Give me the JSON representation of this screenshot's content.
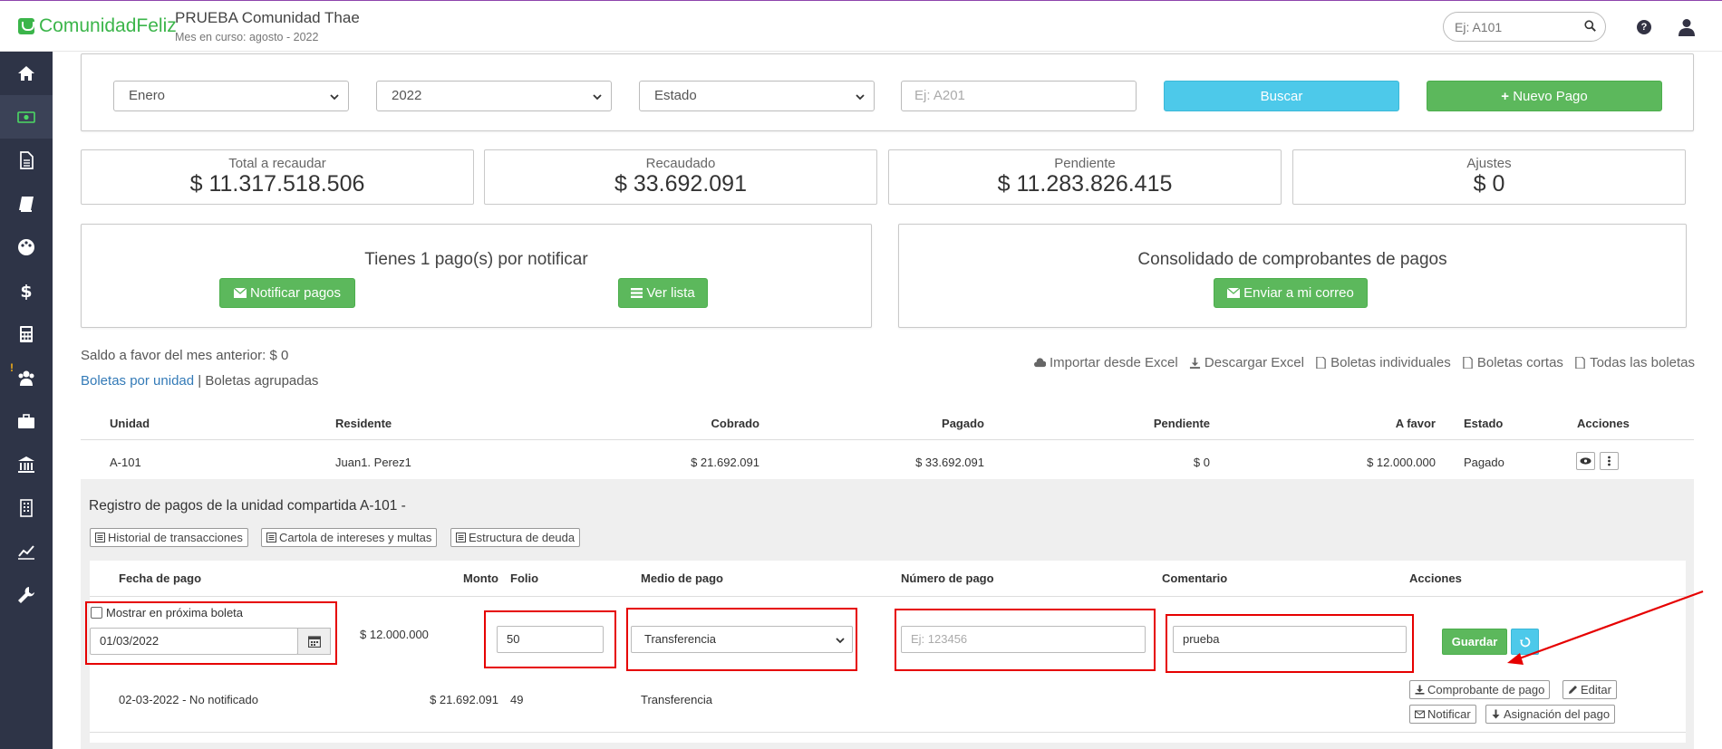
{
  "header": {
    "brand": "ComunidadFeliz",
    "community_name": "PRUEBA Comunidad Thae",
    "current_month": "Mes en curso: agosto - 2022",
    "search_placeholder": "Ej: A101"
  },
  "filters": {
    "month": "Enero",
    "year": "2022",
    "state": "Estado",
    "unit_placeholder": "Ej: A201",
    "search_label": "Buscar",
    "new_payment_label": "Nuevo Pago"
  },
  "stats": [
    {
      "label": "Total a recaudar",
      "value": "$ 11.317.518.506"
    },
    {
      "label": "Recaudado",
      "value": "$ 33.692.091"
    },
    {
      "label": "Pendiente",
      "value": "$ 11.283.826.415"
    },
    {
      "label": "Ajustes",
      "value": "$ 0"
    }
  ],
  "notify": {
    "title": "Tienes 1 pago(s) por notificar",
    "notify_label": "Notificar pagos",
    "list_label": "Ver lista"
  },
  "consolidated": {
    "title": "Consolidado de comprobantes de pagos",
    "email_label": "Enviar a mi correo"
  },
  "saldo": "Saldo a favor del mes anterior: $ 0",
  "views": {
    "by_unit": "Boletas por unidad",
    "separator": "|",
    "grouped": "Boletas agrupadas"
  },
  "tools": {
    "import": "Importar desde Excel",
    "download": "Descargar Excel",
    "individual": "Boletas individuales",
    "short": "Boletas cortas",
    "all": "Todas las boletas"
  },
  "table": {
    "headers": [
      "Unidad",
      "Residente",
      "Cobrado",
      "Pagado",
      "Pendiente",
      "A favor",
      "Estado",
      "Acciones"
    ],
    "row": [
      "A-101",
      "Juan1. Perez1",
      "$ 21.692.091",
      "$ 33.692.091",
      "$ 0",
      "$ 12.000.000",
      "Pagado"
    ]
  },
  "registry": {
    "title": "Registro de pagos de la unidad compartida A-101 -",
    "buttons": [
      "Historial de transacciones",
      "Cartola de intereses y multas",
      "Estructura de deuda"
    ],
    "headers": [
      "Fecha de pago",
      "Monto",
      "Folio",
      "Medio de pago",
      "Número de pago",
      "Comentario",
      "Acciones"
    ],
    "edit_row": {
      "checkbox_label": "Mostrar en próxima boleta",
      "date": "01/03/2022",
      "amount": "$ 12.000.000",
      "folio": "50",
      "method": "Transferencia",
      "number_placeholder": "Ej: 123456",
      "comment": "prueba",
      "save_label": "Guardar"
    },
    "row": {
      "date": "02-03-2022 - No notificado",
      "amount": "$ 21.692.091",
      "folio": "49",
      "method": "Transferencia",
      "actions": [
        "Comprobante de pago",
        "Editar",
        "Notificar",
        "Asignación del pago"
      ]
    }
  },
  "colors": {
    "green": "#5cb85c",
    "info": "#4dc9ea",
    "sidebar": "#2e3447",
    "highlight": "#e60000"
  }
}
